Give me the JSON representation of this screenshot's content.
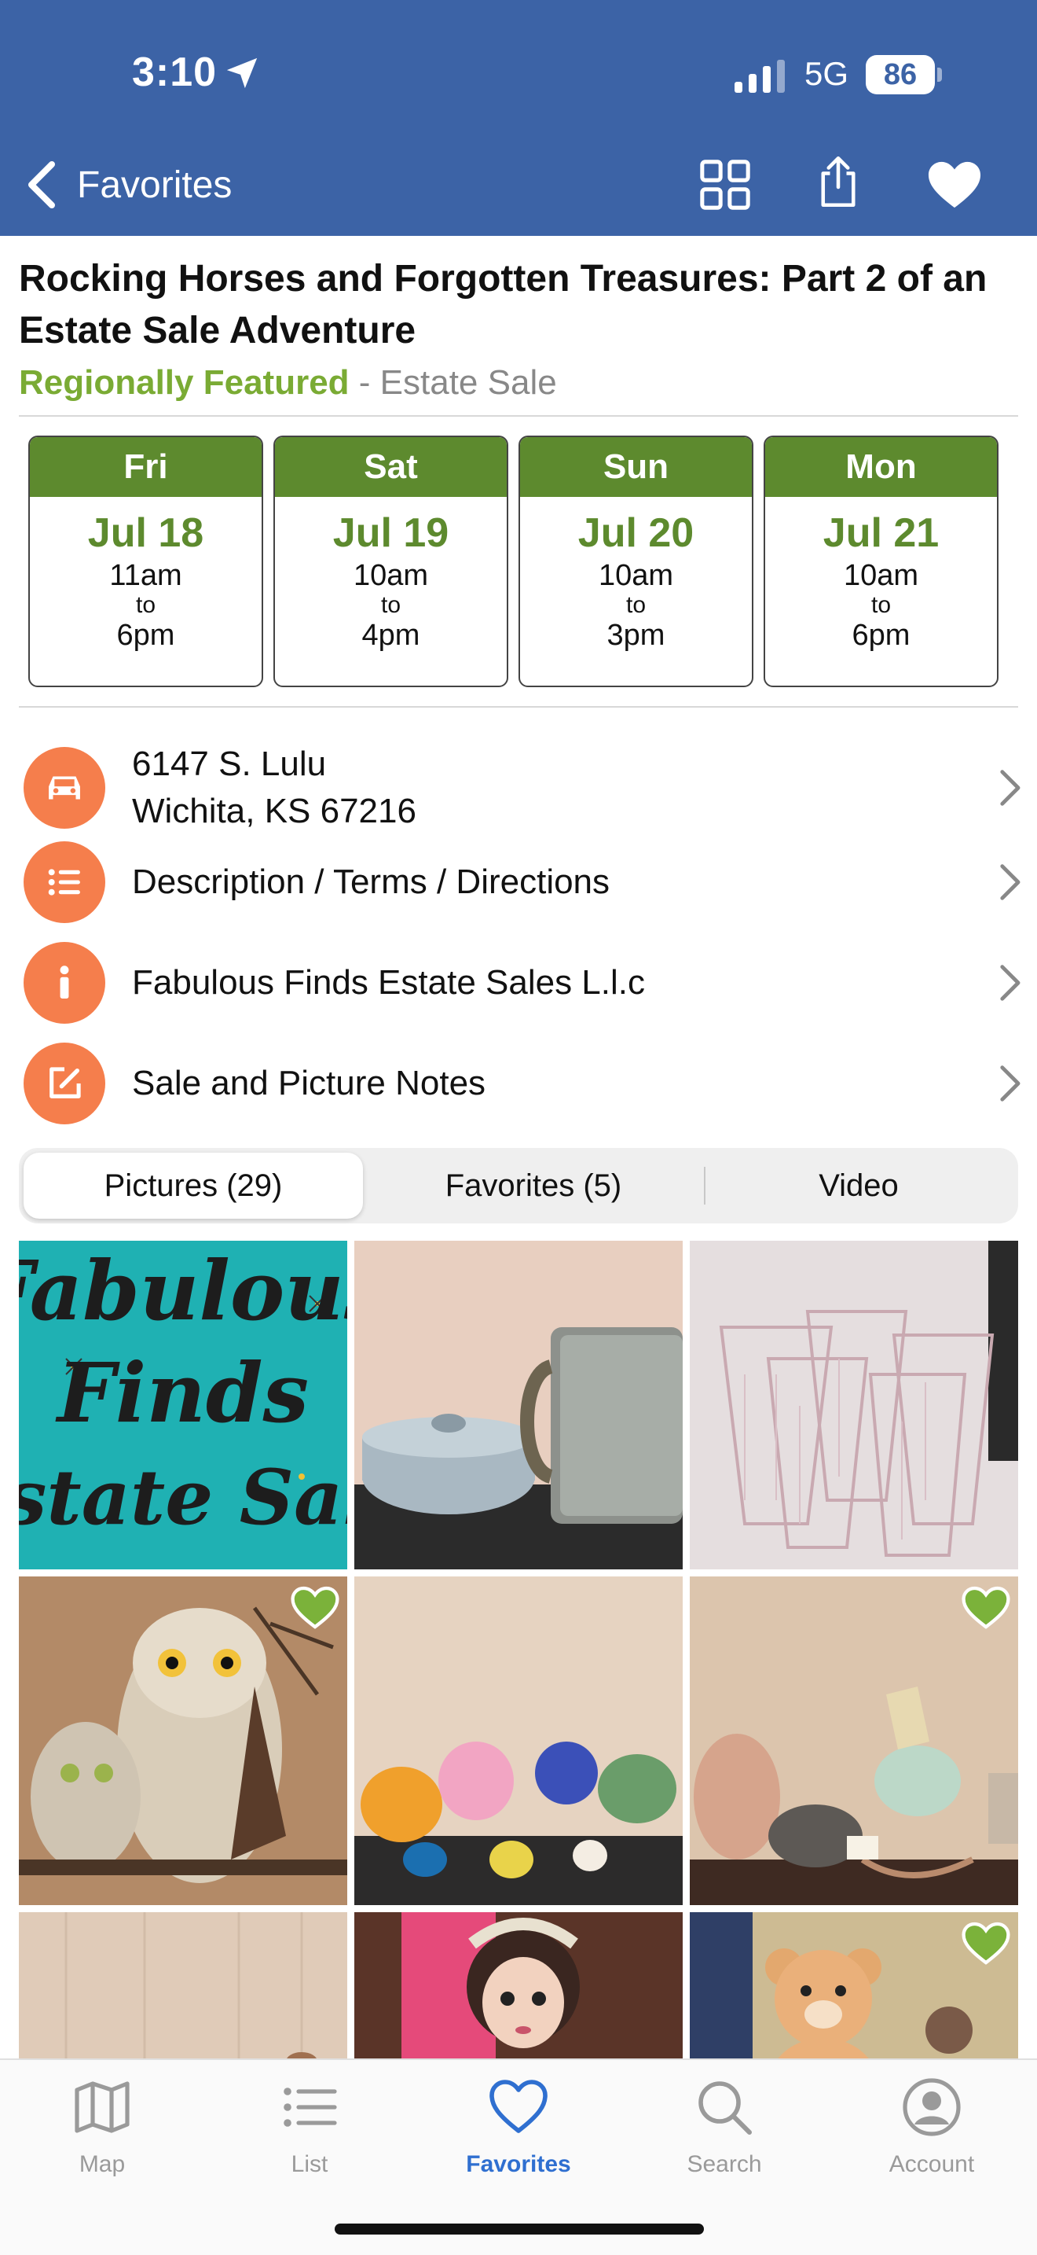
{
  "status_bar": {
    "time": "3:10",
    "network": "5G",
    "battery": "86"
  },
  "nav": {
    "back_label": "Favorites",
    "icons": [
      "grid-icon",
      "share-icon",
      "heart-icon"
    ]
  },
  "sale": {
    "title": "Rocking Horses and Forgotten Treasures:  Part 2 of an Estate Sale Adventure",
    "featured": "Regionally Featured",
    "separator": " - ",
    "type": "Estate Sale"
  },
  "days": [
    {
      "name": "Fri",
      "date": "Jul 18",
      "start": "11am",
      "to": "to",
      "end": "6pm"
    },
    {
      "name": "Sat",
      "date": "Jul 19",
      "start": "10am",
      "to": "to",
      "end": "4pm"
    },
    {
      "name": "Sun",
      "date": "Jul 20",
      "start": "10am",
      "to": "to",
      "end": "3pm"
    },
    {
      "name": "Mon",
      "date": "Jul 21",
      "start": "10am",
      "to": "to",
      "end": "6pm"
    }
  ],
  "rows": {
    "address_line1": "6147 S. Lulu",
    "address_line2": "Wichita, KS 67216",
    "description": "Description / Terms / Directions",
    "company": "Fabulous Finds Estate Sales L.l.c",
    "notes": "Sale and Picture Notes"
  },
  "tabs_segment": {
    "pictures": "Pictures (29)",
    "favorites": "Favorites (5)",
    "video": "Video"
  },
  "photo_logo": {
    "line1": "Fabulous",
    "line2": "Finds",
    "line3": "Estate Sale"
  },
  "tabbar": {
    "map": "Map",
    "list": "List",
    "favorites": "Favorites",
    "search": "Search",
    "account": "Account"
  },
  "colors": {
    "header": "#3c63a6",
    "green": "#5d8a2e",
    "featured": "#7aab34",
    "orange": "#f57e4c",
    "active_tab": "#2f6fd0"
  }
}
